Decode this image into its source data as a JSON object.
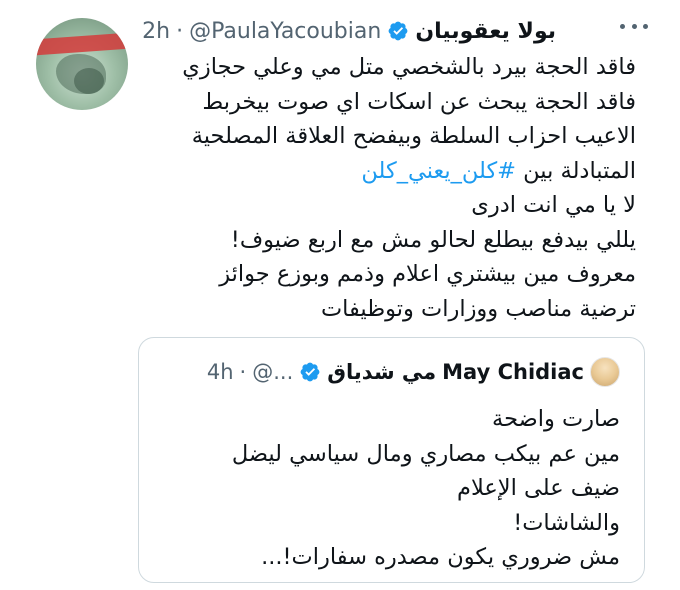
{
  "author": {
    "name": "بولا يعقوبيان",
    "handle": "@PaulaYacoubian",
    "separator": "·",
    "time": "2h",
    "verified_icon": "verified-badge-icon",
    "avatar": "user-avatar"
  },
  "tweet": {
    "lines": [
      "فاقد الحجة بيرد بالشخصي متل مي وعلي حجازي",
      "فاقد الحجة يبحث عن اسكات اي صوت بيخربط",
      "الاعيب احزاب السلطة وبيفضح العلاقة المصلحية",
      "المتبادلة بين",
      "لا يا مي انت ادرى",
      "يللي بيدفع بيطلع لحالو مش مع اربع ضيوف!",
      "معروف مين بيشتري اعلام وذمم وبوزع جوائز",
      "ترضية مناصب ووزارات وتوظيفات"
    ],
    "hashtag": "#كلن_يعني_كلن"
  },
  "quote": {
    "name_latin": "May Chidiac",
    "name_arabic": "مي شدياق",
    "handle": "@...",
    "separator": "·",
    "time": "4h",
    "lines": [
      "صارت واضحة",
      "مين عم بيكب مصاري ومال سياسي ليضل",
      "ضيف على الإعلام",
      "والشاشات!",
      "مش ضروري يكون مصدره سفارات!..."
    ]
  },
  "colors": {
    "text": "#0f1419",
    "muted": "#536471",
    "link": "#1d9bf0",
    "verified": "#1d9bf0",
    "border": "#cfd9de"
  }
}
